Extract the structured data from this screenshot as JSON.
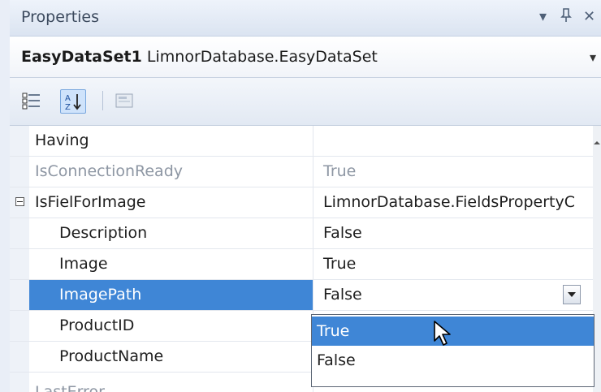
{
  "window": {
    "title": "Properties",
    "buttons": {
      "dropdown": "▾",
      "pin": "ᶦᵖ",
      "close": "✕"
    }
  },
  "object_selector": {
    "name": "EasyDataSet1",
    "type": "LimnorDatabase.EasyDataSet",
    "arrow": "▾"
  },
  "toolbar": {
    "tools": [
      {
        "icon": "categorized-icon",
        "active": false
      },
      {
        "icon": "alphabetical-sort-icon",
        "active": true
      },
      {
        "icon": "property-pages-icon",
        "active": false
      }
    ]
  },
  "grid": {
    "rows": [
      {
        "name": "Having",
        "value": ""
      },
      {
        "name": "IsConnectionReady",
        "value": "True",
        "readonly": true
      },
      {
        "name": "IsFielForImage",
        "value": "LimnorDatabase.FieldsPropertyC",
        "expander": "⊟"
      },
      {
        "name": "Description",
        "value": "False"
      },
      {
        "name": "Image",
        "value": "True"
      },
      {
        "name": "ImagePath",
        "value": "False",
        "selected": true
      },
      {
        "name": "ProductID",
        "value": ""
      },
      {
        "name": "ProductName",
        "value": ""
      },
      {
        "name": "LastError",
        "value": ""
      }
    ]
  },
  "dropdown": {
    "options": [
      "True",
      "False"
    ],
    "hovered": "True"
  },
  "colors": {
    "selection": "#3f86d6",
    "readonly_text": "#8d96a3"
  }
}
